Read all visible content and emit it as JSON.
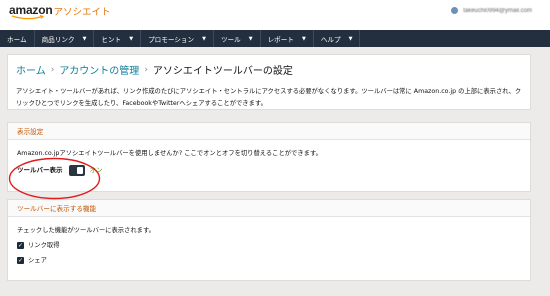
{
  "header": {
    "logo_word": "amazon",
    "logo_suffix": "アソシエイト",
    "user_email": "takeuchi0994@ymail.com"
  },
  "nav": {
    "items": [
      {
        "label": "ホーム",
        "caret": false
      },
      {
        "label": "商品リンク",
        "caret": true
      },
      {
        "label": "ヒント",
        "caret": true
      },
      {
        "label": "プロモーション",
        "caret": true
      },
      {
        "label": "ツール",
        "caret": true
      },
      {
        "label": "レポート",
        "caret": true
      },
      {
        "label": "ヘルプ",
        "caret": true
      }
    ],
    "caret_glyph": "▼"
  },
  "breadcrumb": {
    "home": "ホーム",
    "account": "アカウントの管理",
    "current": "アソシエイトツールバーの設定",
    "separator": "›"
  },
  "intro": {
    "line1": "アソシエイト・ツールバーがあれば、リンク作成のたびにアソシエイト・セントラルにアクセスする必要がなくなります。ツールバーは常に Amazon.co.jp の上部に表示され、ク",
    "line2": "リックひとつでリンクを生成したり、FacebookやTwitterへシェアすることができます。"
  },
  "display_settings": {
    "title": "表示設定",
    "description": "Amazon.co.jpアソシエイトツールバーを使用しませんか? ここでオンとオフを切り替えることができます。",
    "toggle_label": "ツールバー表示",
    "toggle_state": "オン"
  },
  "features": {
    "title": "ツールバーに表示する機能",
    "description": "チェックした機能がツールバーに表示されます。",
    "items": [
      {
        "label": "リンク取得",
        "checked": true
      },
      {
        "label": "シェア",
        "checked": true
      }
    ],
    "check_glyph": "✓"
  },
  "colors": {
    "nav_bg": "#232f3e",
    "link": "#0f7d97",
    "section_title": "#c45500",
    "toggle_on": "#4aa500",
    "annotation": "#e01b1b"
  }
}
